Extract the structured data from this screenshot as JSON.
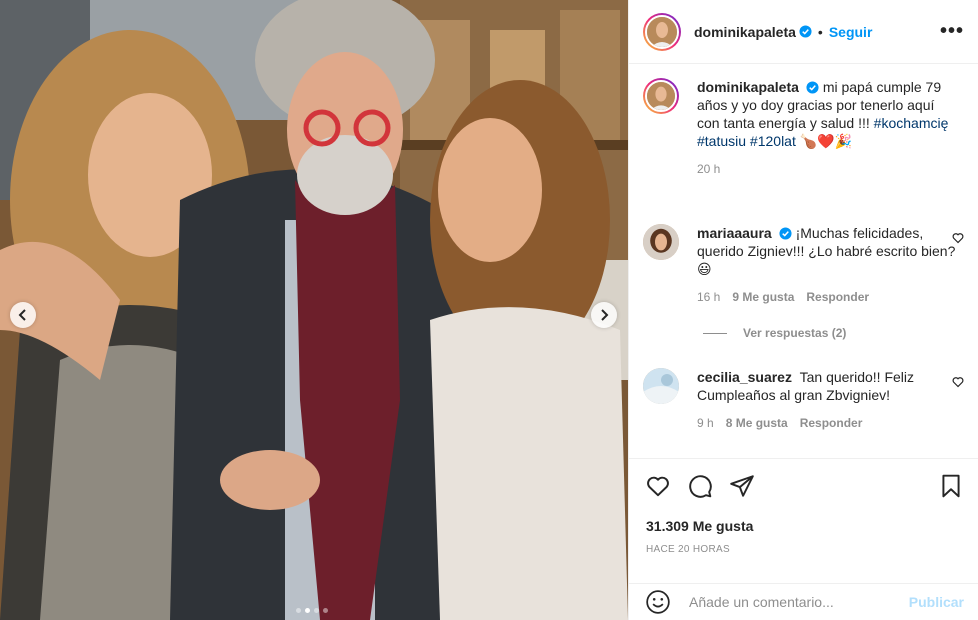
{
  "post": {
    "author": "dominikapaleta",
    "follow_label": "Seguir",
    "separator": "•",
    "more_label": "•••"
  },
  "caption": {
    "username": "dominikapaleta",
    "text": "mi papá cumple 79 años y yo doy gracias por tenerlo aquí con tanta energía y salud !!!",
    "hashtags": "#kochamcię #tatusiu #120lat",
    "emojis": "🍗❤️🎉",
    "time": "20 h"
  },
  "comments": [
    {
      "username": "mariaaaura",
      "verified": true,
      "text": "¡Muchas felicidades, querido Zigniev!!! ¿Lo habré escrito bien? 😃",
      "time": "16 h",
      "likes": "9 Me gusta",
      "reply": "Responder"
    },
    {
      "username": "cecilia_suarez",
      "verified": false,
      "text": "Tan querido!! Feliz Cumpleaños al gran Zbvigniev!",
      "time": "9 h",
      "likes": "8 Me gusta",
      "reply": "Responder"
    }
  ],
  "view_replies": "Ver respuestas (2)",
  "likes_total": "31.309 Me gusta",
  "posted_ago": "HACE 20 HORAS",
  "composer": {
    "placeholder": "Añade un comentario...",
    "publish_label": "Publicar"
  },
  "carousel": {
    "dots": 4,
    "active": 1
  },
  "colors": {
    "accent": "#0095f6",
    "link": "#00376b",
    "muted": "#8e8e8e",
    "publish_disabled": "#b2dffc"
  },
  "icons": [
    "chevron-left-icon",
    "chevron-right-icon",
    "verified-badge-icon",
    "more-icon",
    "heart-icon",
    "comment-icon",
    "share-icon",
    "bookmark-icon",
    "emoji-icon"
  ]
}
